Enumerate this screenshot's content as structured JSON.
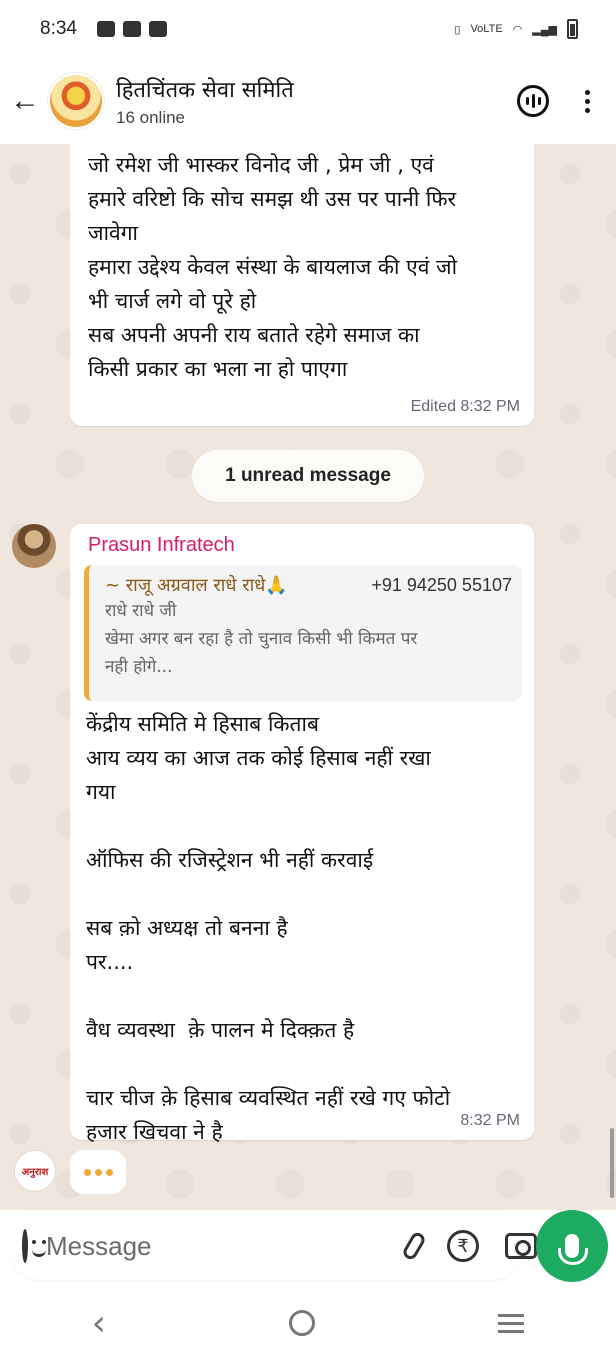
{
  "status_bar": {
    "time": "8:34",
    "network_label": "VoLTE"
  },
  "header": {
    "group_name": "हितचिंतक सेवा समिति",
    "online_status": "16 online"
  },
  "messages": {
    "top": {
      "text": "जो रमेश जी भास्कर विनोद जी , प्रेम जी , एवं\nहमारे वरिष्टो कि सोच समझ थी उस पर पानी फिर\nजावेगा\nहमारा उद्देश्य केवल संस्था के बायलाज की एवं जो\nभी चार्ज लगे वो पूरे हो\nसब अपनी अपनी राय बताते रहेगे समाज का\nकिसी प्रकार का भला ना हो पाएगा",
      "meta": "Edited 8:32 PM"
    },
    "unread_label": "1 unread message",
    "main": {
      "sender": "Prasun Infratech",
      "quote_author": "~ राजू अग्रवाल राधे राधे🙏",
      "quote_phone": "+91 94250 55107",
      "quote_line1": "राधे राधे जी",
      "quote_line2": "खेमा अगर बन रहा है तो चुनाव किसी भी किमत पर",
      "quote_line3": "नही होगे...",
      "text": "केंद्रीय समिति मे हिसाब किताब\nआय व्यय का आज तक कोई हिसाब नहीं रखा\nगया\n\nऑफिस की रजिस्ट्रेशन भी नहीं करवाई\n\nसब क़ो अध्यक्ष तो बनना है\nपर....\n\nवैध व्यवस्था  क़े पालन मे दिक्क़त है\n\nचार चीज क़े हिसाब व्यवस्थित नहीं रखे गए फोटो\nहजार खिचवा ने है",
      "time": "8:32 PM"
    },
    "typing_avatar_text": "अनुराश"
  },
  "composer": {
    "placeholder": "Message",
    "rupee_symbol": "₹"
  },
  "colors": {
    "sender_name": "#d81b68",
    "mic_button": "#1daa61",
    "quote_bar": "#f2a93b",
    "chat_bg": "#efe7dd"
  },
  "icons": [
    "back-arrow-icon",
    "group-avatar",
    "voice-chat-icon",
    "more-options-icon",
    "emoji-icon",
    "attach-icon",
    "rupee-icon",
    "camera-icon",
    "mic-icon",
    "nav-back-icon",
    "nav-home-icon",
    "nav-recents-icon"
  ]
}
